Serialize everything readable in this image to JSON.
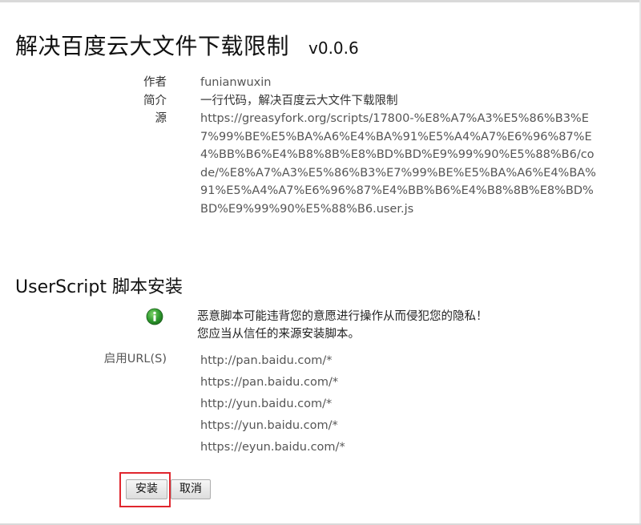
{
  "script": {
    "title": "解决百度云大文件下载限制",
    "version": "v0.0.6"
  },
  "meta": {
    "author_label": "作者",
    "author_value": "funianwuxin",
    "description_label": "简介",
    "description_value": "一行代码，解决百度云大文件下载限制",
    "source_label": "源",
    "source_value": "https://greasyfork.org/scripts/17800-%E8%A7%A3%E5%86%B3%E7%99%BE%E5%BA%A6%E4%BA%91%E5%A4%A7%E6%96%87%E4%BB%B6%E4%B8%8B%E8%BD%BD%E9%99%90%E5%88%B6/code/%E8%A7%A3%E5%86%B3%E7%99%BE%E5%BA%A6%E4%BA%91%E5%A4%A7%E6%96%87%E4%BB%B6%E4%B8%8B%E8%BD%BD%E9%99%90%E5%88%B6.user.js"
  },
  "install": {
    "section_title": "UserScript 脚本安装",
    "warning_line1": "恶意脚本可能违背您的意愿进行操作从而侵犯您的隐私！",
    "warning_line2": "您应当从信任的来源安装脚本。",
    "icon": "info-icon",
    "icon_color": "#2e8b2e",
    "urls_label": "启用URL(S)",
    "urls": [
      "http://pan.baidu.com/*",
      "https://pan.baidu.com/*",
      "http://yun.baidu.com/*",
      "https://yun.baidu.com/*",
      "https://eyun.baidu.com/*"
    ]
  },
  "buttons": {
    "install_label": "安装",
    "cancel_label": "取消"
  },
  "highlight_color": "#e0262e"
}
